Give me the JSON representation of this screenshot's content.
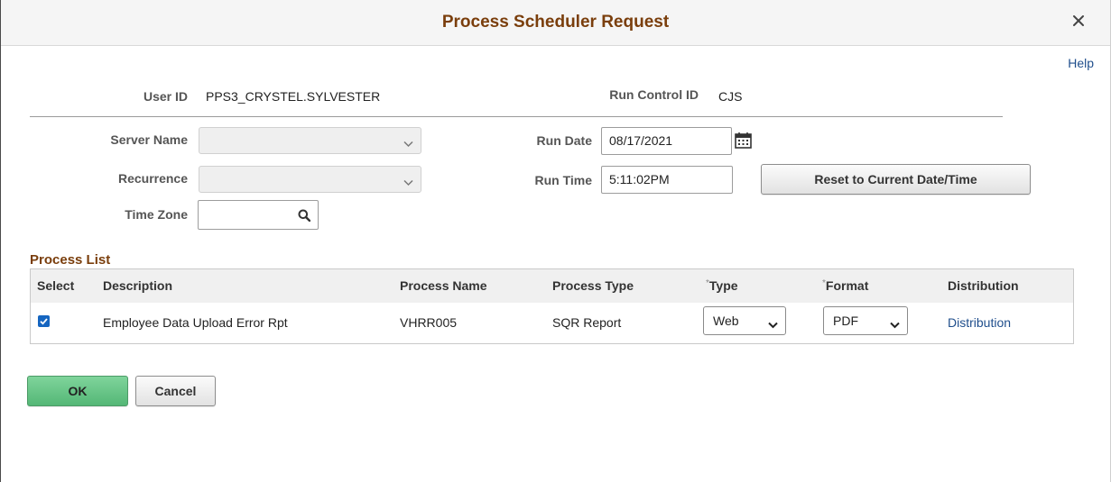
{
  "dialog": {
    "title": "Process Scheduler Request",
    "close_label": "×",
    "help_label": "Help"
  },
  "user": {
    "user_id_label": "User ID",
    "user_id": "PPS3_CRYSTEL.SYLVESTER",
    "run_control_label": "Run Control ID",
    "run_control_id": "CJS"
  },
  "form": {
    "server_name_label": "Server Name",
    "server_name": "",
    "recurrence_label": "Recurrence",
    "recurrence": "",
    "time_zone_label": "Time Zone",
    "time_zone": "",
    "run_date_label": "Run Date",
    "run_date": "08/17/2021",
    "run_time_label": "Run Time",
    "run_time": "5:11:02PM",
    "reset_label": "Reset to Current Date/Time"
  },
  "process_list": {
    "title": "Process List",
    "columns": [
      "Select",
      "Description",
      "Process Name",
      "Process Type",
      "Type",
      "Format",
      "Distribution"
    ],
    "rows": [
      {
        "selected": true,
        "description": "Employee Data Upload Error Rpt",
        "process_name": "VHRR005",
        "process_type": "SQR Report",
        "type": "Web",
        "format": "PDF",
        "distribution": "Distribution"
      }
    ]
  },
  "actions": {
    "ok_label": "OK",
    "cancel_label": "Cancel"
  },
  "icons": {
    "close": "close-icon",
    "chevron": "chevron-down-icon",
    "calendar": "calendar-icon",
    "search": "search-icon",
    "check": "checkbox-checked-icon"
  },
  "colors": {
    "title": "#7a3e0c",
    "link": "#1f4e8c",
    "ok": "#5dbd7e",
    "checkbox": "#1565c0"
  }
}
